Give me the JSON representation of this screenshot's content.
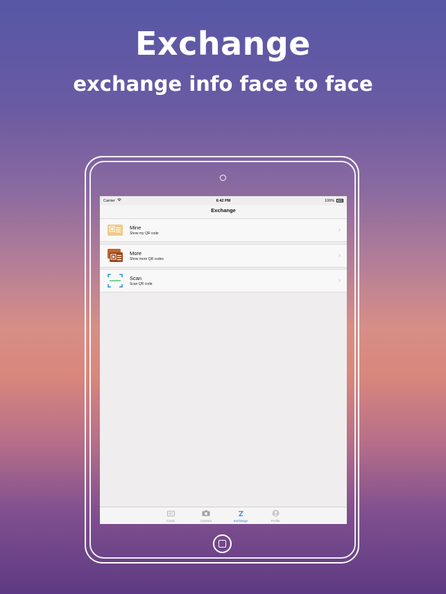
{
  "hero": {
    "title": "Exchange",
    "subtitle": "exchange info face to face"
  },
  "statusbar": {
    "carrier": "Carrier",
    "time": "6:42 PM",
    "battery": "100%"
  },
  "navbar": {
    "title": "Exchange"
  },
  "rows": [
    {
      "title": "Mine",
      "subtitle": "Show my QR code",
      "icon": "qr-card-icon"
    },
    {
      "title": "More",
      "subtitle": "Show more QR codes",
      "icon": "qr-cards-stack-icon"
    },
    {
      "title": "Scan",
      "subtitle": "Scan QR code",
      "icon": "scan-frame-icon"
    }
  ],
  "tabs": [
    {
      "label": "Cards",
      "icon": "cards-icon",
      "active": false
    },
    {
      "label": "Camera",
      "icon": "camera-icon",
      "active": false
    },
    {
      "label": "Exchange",
      "icon": "exchange-icon",
      "active": true
    },
    {
      "label": "Profile",
      "icon": "profile-icon",
      "active": false
    }
  ],
  "colors": {
    "accent": "#2f7de1",
    "row_icon_light": "#f0c98a",
    "row_icon_dark": "#9b4a1e",
    "scan_blue": "#2b8fe0",
    "scan_green": "#3ec46d"
  }
}
